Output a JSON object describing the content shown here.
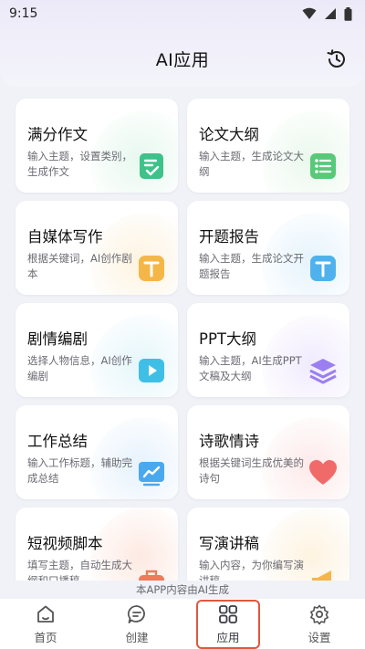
{
  "status_bar": {
    "time": "9:15"
  },
  "header": {
    "title": "AI应用",
    "history_icon": "history-clock-icon"
  },
  "cards": [
    {
      "title": "满分作文",
      "desc": "输入主题，设置类别，生成作文",
      "icon": "document-check-icon",
      "color": "#3ec28a",
      "tint": "#e7f8ef"
    },
    {
      "title": "论文大纲",
      "desc": "输入主题，生成论文大纲",
      "icon": "list-icon",
      "color": "#58c978",
      "tint": "#eaf8ec"
    },
    {
      "title": "自媒体写作",
      "desc": "根据关键词，AI创作剧本",
      "icon": "text-t-icon",
      "color": "#f5b648",
      "tint": "#fdf3e0"
    },
    {
      "title": "开题报告",
      "desc": "输入主题，生成论文开题报告",
      "icon": "text-t-icon",
      "color": "#4fb2ec",
      "tint": "#e5f3fc"
    },
    {
      "title": "剧情编剧",
      "desc": "选择人物信息，AI创作编剧",
      "icon": "video-play-icon",
      "color": "#3fbfe6",
      "tint": "#e5f6fb"
    },
    {
      "title": "PPT大纲",
      "desc": "输入主题，AI生成PPT文稿及大纲",
      "icon": "layers-icon",
      "color": "#9b7ff0",
      "tint": "#f0ebfd"
    },
    {
      "title": "工作总结",
      "desc": "输入工作标题，辅助完成总结",
      "icon": "trend-chart-icon",
      "color": "#4aa8ef",
      "tint": "#e6f2fc"
    },
    {
      "title": "诗歌情诗",
      "desc": "根据关键词生成优美的诗句",
      "icon": "heart-icon",
      "color": "#f06a6a",
      "tint": "#fde9e9"
    },
    {
      "title": "短视频脚本",
      "desc": "填写主题，自动生成大纲和口播稿",
      "icon": "briefcase-icon",
      "color": "#f07a5a",
      "tint": "#fde9e2"
    },
    {
      "title": "写演讲稿",
      "desc": "输入内容，为你编写演讲稿",
      "icon": "megaphone-icon",
      "color": "#f5b648",
      "tint": "#fdf3e0"
    }
  ],
  "notice": "本APP内容由AI生成",
  "tabs": [
    {
      "label": "首页",
      "icon": "home-icon",
      "active": false
    },
    {
      "label": "创建",
      "icon": "chat-bubble-icon",
      "active": false
    },
    {
      "label": "应用",
      "icon": "apps-icon",
      "active": true
    },
    {
      "label": "设置",
      "icon": "settings-icon",
      "active": false
    }
  ]
}
